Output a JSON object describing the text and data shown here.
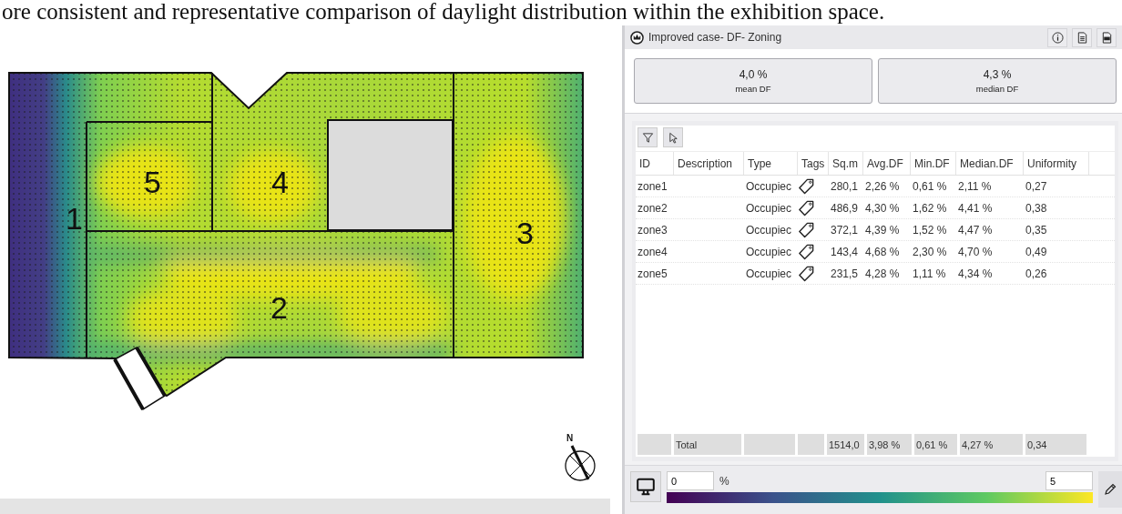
{
  "caption_text": "ore consistent and representative comparison of daylight distribution within the exhibition space.",
  "floor_plan": {
    "zones": [
      {
        "label": "1"
      },
      {
        "label": "5"
      },
      {
        "label": "4"
      },
      {
        "label": "3"
      },
      {
        "label": "2"
      }
    ]
  },
  "compass": {
    "label": "N"
  },
  "panel": {
    "title": "Improved case- DF- Zoning",
    "stats": [
      {
        "value": "4,0 %",
        "label": "mean DF"
      },
      {
        "value": "4,3 %",
        "label": "median DF"
      }
    ]
  },
  "table": {
    "columns": [
      "ID",
      "Description",
      "Type",
      "Tags",
      "Sq.m",
      "Avg.DF",
      "Min.DF",
      "Median.DF",
      "Uniformity"
    ],
    "rows": [
      {
        "id": "zone1",
        "type": "Occupiec",
        "sq_m": "280,1",
        "avg_df": "2,26 %",
        "min_df": "0,61 %",
        "median_df": "2,11 %",
        "uniformity": "0,27"
      },
      {
        "id": "zone2",
        "type": "Occupiec",
        "sq_m": "486,9",
        "avg_df": "4,30 %",
        "min_df": "1,62 %",
        "median_df": "4,41 %",
        "uniformity": "0,38"
      },
      {
        "id": "zone3",
        "type": "Occupiec",
        "sq_m": "372,1",
        "avg_df": "4,39 %",
        "min_df": "1,52 %",
        "median_df": "4,47 %",
        "uniformity": "0,35"
      },
      {
        "id": "zone4",
        "type": "Occupiec",
        "sq_m": "143,4",
        "avg_df": "4,68 %",
        "min_df": "2,30 %",
        "median_df": "4,70 %",
        "uniformity": "0,49"
      },
      {
        "id": "zone5",
        "type": "Occupiec",
        "sq_m": "231,5",
        "avg_df": "4,28 %",
        "min_df": "1,11 %",
        "median_df": "4,34 %",
        "uniformity": "0,26"
      }
    ],
    "total": {
      "label": "Total",
      "sq_m": "1514,0",
      "avg_df": "3,98 %",
      "min_df": "0,61 %",
      "median_df": "4,27 %",
      "uniformity": "0,34"
    }
  },
  "legend": {
    "min": "0",
    "unit": "%",
    "max": "5"
  }
}
